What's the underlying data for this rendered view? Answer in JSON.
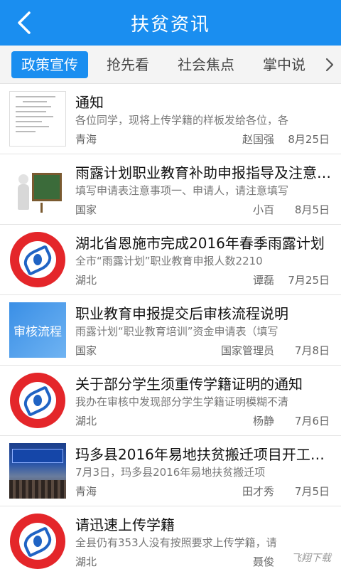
{
  "header": {
    "title": "扶贫资讯",
    "back_icon": "chevron-left-icon"
  },
  "tabs": [
    {
      "label": "政策宣传",
      "active": true
    },
    {
      "label": "抢先看",
      "active": false
    },
    {
      "label": "社会焦点",
      "active": false
    },
    {
      "label": "掌中说",
      "active": false
    }
  ],
  "tab_more_icon": "chevron-right-icon",
  "colors": {
    "accent": "#1a8ef0",
    "badge_red": "#e4262a"
  },
  "news": [
    {
      "title": "通知",
      "summary": "各位同学，现将上传学籍的样板发给各位，各",
      "region": "青海",
      "author": "赵国强",
      "date": "8月25日",
      "thumb": "document-thumbnail"
    },
    {
      "title": "雨露计划职业教育补助申报指导及注意事项",
      "summary": "填写申请表注意事项一、申请人，请注意填写",
      "region": "国家",
      "author": "小百",
      "date": "8月5日",
      "thumb": "teacher-blackboard-thumbnail"
    },
    {
      "title": "湖北省恩施市完成2016年春季雨露计划",
      "summary": "全市“雨露计划”职业教育申报人数2210",
      "region": "湖北",
      "author": "谭磊",
      "date": "7月25日",
      "thumb": "poverty-info-badge-thumbnail"
    },
    {
      "title": "职业教育申报提交后审核流程说明",
      "summary": "雨露计划“职业教育培训”资金申请表（填写",
      "region": "国家",
      "author": "国家管理员",
      "date": "7月8日",
      "thumb": "audit-flow-thumbnail",
      "thumb_text": "审核流程"
    },
    {
      "title": "关于部分学生须重传学籍证明的通知",
      "summary": "我办在审核中发现部分学生学籍证明模糊不清",
      "region": "湖北",
      "author": "杨静",
      "date": "7月6日",
      "thumb": "poverty-info-badge-thumbnail"
    },
    {
      "title": "玛多县2016年易地扶贫搬迁项目开工仪式",
      "summary": "7月3日，玛多县2016年易地扶贫搬迁项",
      "region": "青海",
      "author": "田才秀",
      "date": "7月5日",
      "thumb": "ceremony-photo-thumbnail"
    },
    {
      "title": "请迅速上传学籍",
      "summary": "全县仍有353人没有按照要求上传学籍，请",
      "region": "湖北",
      "author": "聂俊",
      "date": "",
      "thumb": "poverty-info-badge-thumbnail"
    }
  ],
  "watermark": "飞翔下载"
}
